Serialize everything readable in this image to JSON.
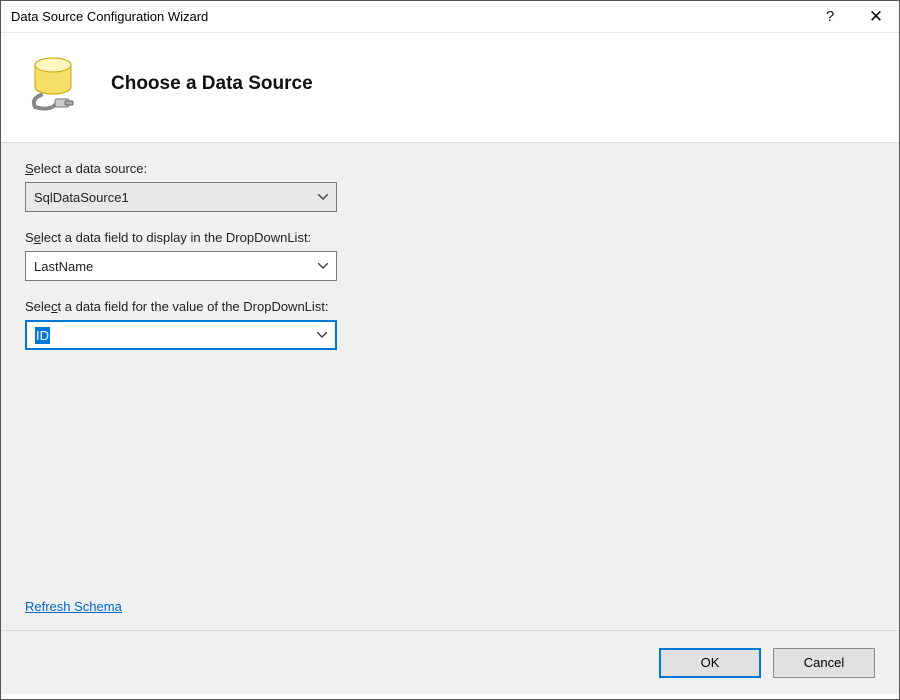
{
  "window": {
    "title": "Data Source Configuration Wizard",
    "help_symbol": "?",
    "close_symbol": "✕"
  },
  "header": {
    "title": "Choose a Data Source"
  },
  "form": {
    "datasource": {
      "label_pre": "S",
      "label_rest": "elect a data source:",
      "value": "SqlDataSource1"
    },
    "displayfield": {
      "label": "S",
      "label_u": "e",
      "label_rest": "lect a data field to display in the DropDownList:",
      "value": "LastName"
    },
    "valuefield": {
      "label": "Sele",
      "label_u": "c",
      "label_rest": "t a data field for the value of the DropDownList:",
      "value": "ID"
    }
  },
  "links": {
    "refresh": "Refresh Schema"
  },
  "buttons": {
    "ok": "OK",
    "cancel": "Cancel"
  }
}
